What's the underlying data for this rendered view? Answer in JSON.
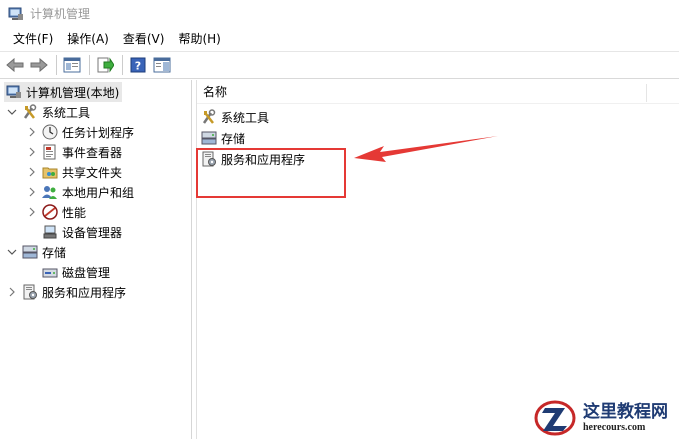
{
  "window": {
    "title": "计算机管理"
  },
  "menu": [
    "文件(F)",
    "操作(A)",
    "查看(V)",
    "帮助(H)"
  ],
  "toolbar": {
    "icons": [
      "back-icon",
      "forward-icon",
      "show-hide-tree-icon",
      "export-list-icon",
      "help-icon",
      "action-pane-icon"
    ]
  },
  "tree": {
    "root": "计算机管理(本地)",
    "system_tools": "系统工具",
    "task_scheduler": "任务计划程序",
    "event_viewer": "事件查看器",
    "shared_folders": "共享文件夹",
    "local_users": "本地用户和组",
    "performance": "性能",
    "device_manager": "设备管理器",
    "storage": "存储",
    "disk_management": "磁盘管理",
    "services_apps": "服务和应用程序"
  },
  "list": {
    "column_name": "名称",
    "items": [
      "系统工具",
      "存储",
      "服务和应用程序"
    ]
  },
  "watermark": {
    "main": "这里教程网",
    "sub": "herecours.com"
  },
  "colors": {
    "annotation": "#e53935",
    "selection": "#e8e8e8",
    "brand": "#1f3b73"
  }
}
